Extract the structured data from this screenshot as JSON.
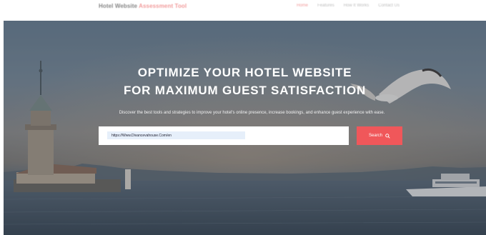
{
  "header": {
    "brand_primary": "Hotel Website",
    "brand_accent": "Assessment Tool",
    "nav": [
      "Home",
      "Features",
      "How It Works",
      "Contact Us"
    ]
  },
  "hero": {
    "title_line1": "OPTIMIZE YOUR HOTEL WEBSITE",
    "title_line2": "FOR MAXIMUM GUEST SATISFACTION",
    "subtitle": "Discover the best tools and strategies to improve your hotel's online presence, increase bookings, and enhance guest experience with ease."
  },
  "search": {
    "value": "https://Www.Divancevahouse.Com/en",
    "button_label": "Search"
  },
  "colors": {
    "accent": "#f0575a",
    "input_bg": "#e6effa"
  }
}
